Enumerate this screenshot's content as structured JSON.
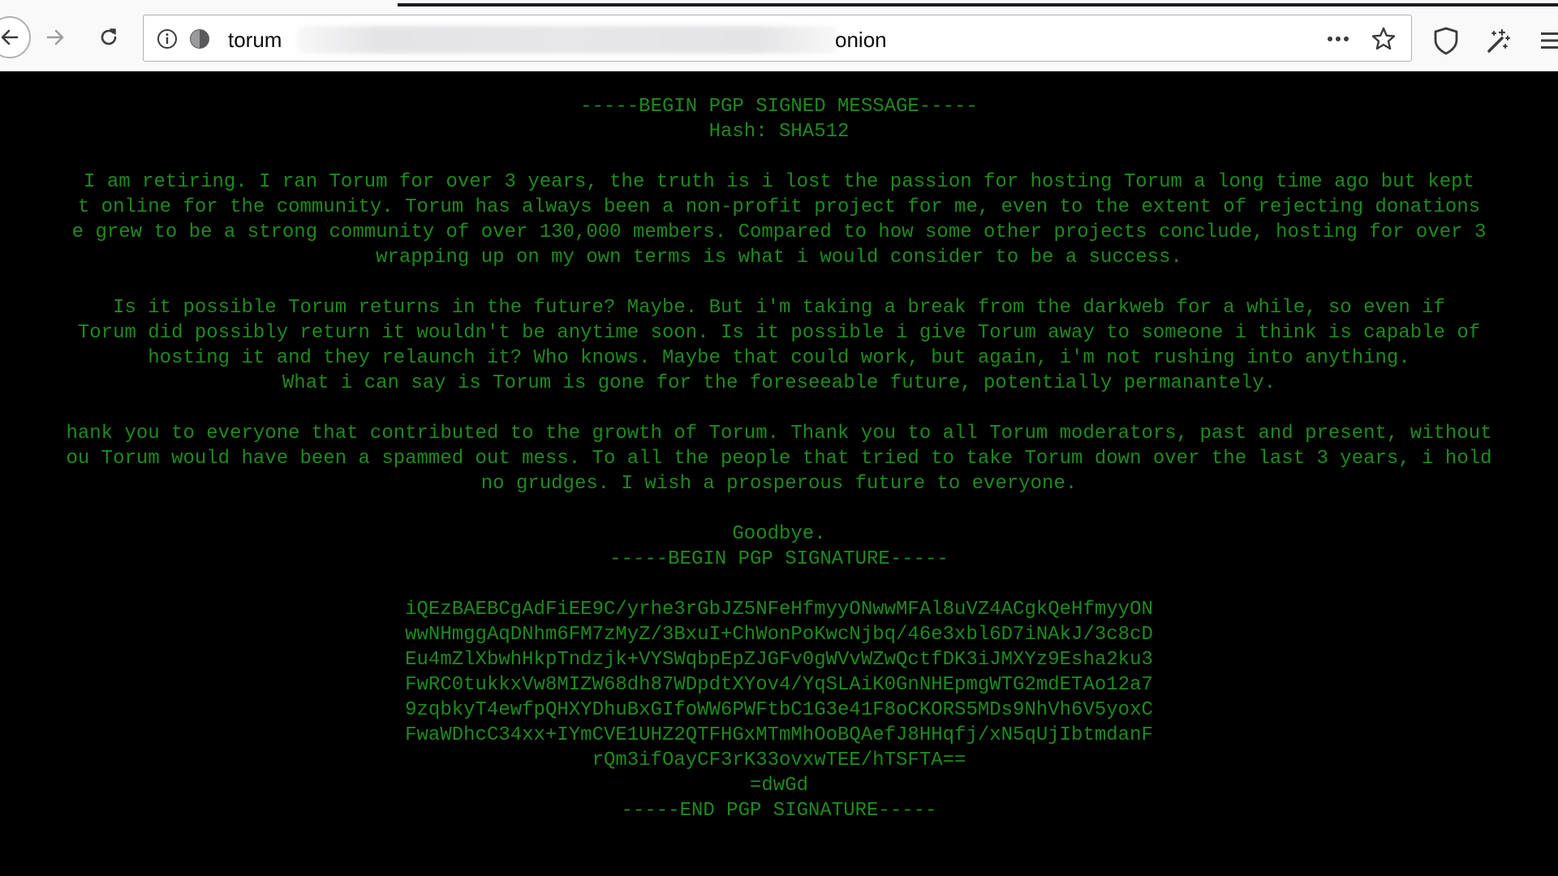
{
  "browser": {
    "url_prefix": "torum",
    "url_suffix": "onion",
    "icons": {
      "back": "back-arrow-icon",
      "forward": "forward-arrow-icon",
      "reload": "reload-icon",
      "info": "info-icon",
      "tracking": "tracking-protection-icon",
      "page_actions": "more-horizontal-icon",
      "bookmark": "star-icon",
      "shield": "shield-icon",
      "extension": "wand-icon",
      "menu": "hamburger-menu-icon"
    }
  },
  "message": {
    "header": {
      "begin_signed": "-----BEGIN PGP SIGNED MESSAGE-----",
      "hash": "Hash: SHA512"
    },
    "paragraph1": [
      "I am retiring. I ran Torum for over 3 years, the truth is i lost the passion for hosting Torum a long time ago but kept",
      "t online for the community. Torum has always been a non-profit project for me, even to the extent of rejecting donations",
      "e grew to be a strong community of over 130,000 members. Compared to how some other projects conclude, hosting for over 3",
      "wrapping up on my own terms is what i would consider to be a success."
    ],
    "paragraph2": [
      "Is it possible Torum returns in the future? Maybe. But i'm taking a break from the darkweb for a while, so even if",
      "Torum did possibly return it wouldn't be anytime soon. Is it possible i give Torum away to someone i think is capable of",
      "hosting it and they relaunch it? Who knows. Maybe that could work, but again, i'm not rushing into anything.",
      "What i can say is Torum is gone for the foreseeable future, potentially permanantely."
    ],
    "paragraph3": [
      "hank you to everyone that contributed to the growth of Torum. Thank you to all Torum moderators, past and present, without",
      "ou Torum would have been a spammed out mess. To all the people that tried to take Torum down over the last 3 years, i hold",
      "no grudges. I wish a prosperous future to everyone."
    ],
    "goodbye": "Goodbye.",
    "signature": {
      "begin": "-----BEGIN PGP SIGNATURE-----",
      "lines": [
        "iQEzBAEBCgAdFiEE9C/yrhe3rGbJZ5NFeHfmyyONwwMFAl8uVZ4ACgkQeHfmyyON",
        "wwNHmggAqDNhm6FM7zMyZ/3BxuI+ChWonPoKwcNjbq/46e3xbl6D7iNAkJ/3c8cD",
        "Eu4mZlXbwhHkpTndzjk+VYSWqbpEpZJGFv0gWVvWZwQctfDK3iJMXYz9Esha2ku3",
        "FwRC0tukkxVw8MIZW68dh87WDpdtXYov4/YqSLAiK0GnNHEpmgWTG2mdETAo12a7",
        "9zqbkyT4ewfpQHXYDhuBxGIfoWW6PWFtbC1G3e41F8oCKORS5MDs9NhVh6V5yoxC",
        "FwaWDhcC34xx+IYmCVE1UHZ2QTFHGxMTmMhOoBQAefJ8HHqfj/xN5qUjIbtmdanF",
        "rQm3ifOayCF3rK33ovxwTEE/hTSFTA==",
        "=dwGd"
      ],
      "end": "-----END PGP SIGNATURE-----"
    }
  },
  "colors": {
    "page_background": "#000000",
    "text_green": "#1f8a1f",
    "toolbar": "#f9f9fa"
  }
}
